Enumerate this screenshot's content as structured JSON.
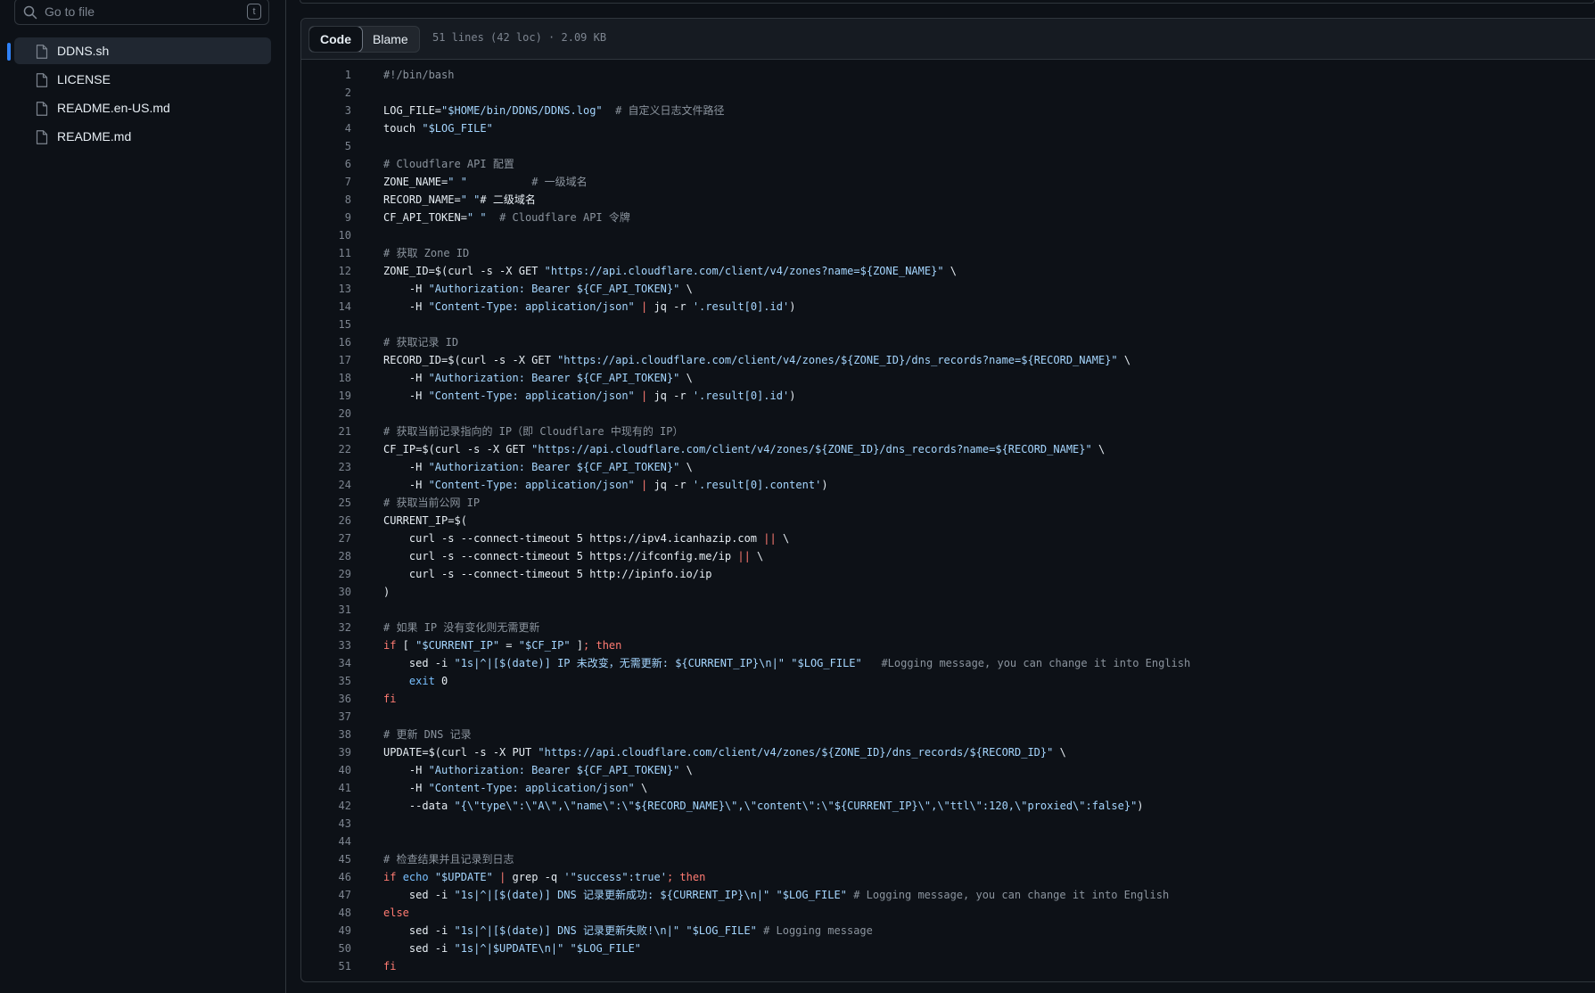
{
  "sidebar": {
    "search_placeholder": "Go to file",
    "search_shortcut": "t",
    "files": [
      {
        "name": "DDNS.sh",
        "active": true
      },
      {
        "name": "LICENSE",
        "active": false
      },
      {
        "name": "README.en-US.md",
        "active": false
      },
      {
        "name": "README.md",
        "active": false
      }
    ]
  },
  "code_view": {
    "tabs": [
      "Code",
      "Blame"
    ],
    "selected_tab": "Code",
    "meta": "51 lines (42 loc) · 2.09 KB",
    "lines": [
      "#!/bin/bash",
      "",
      "LOG_FILE=\"$HOME/bin/DDNS/DDNS.log\"  # 自定义日志文件路径",
      "touch \"$LOG_FILE\"",
      "",
      "# Cloudflare API 配置",
      "ZONE_NAME=\" \"          # 一级域名",
      "RECORD_NAME=\" \"# 二级域名",
      "CF_API_TOKEN=\" \"  # Cloudflare API 令牌",
      "",
      "# 获取 Zone ID",
      "ZONE_ID=$(curl -s -X GET \"https://api.cloudflare.com/client/v4/zones?name=${ZONE_NAME}\" \\",
      "    -H \"Authorization: Bearer ${CF_API_TOKEN}\" \\",
      "    -H \"Content-Type: application/json\" | jq -r '.result[0].id')",
      "",
      "# 获取记录 ID",
      "RECORD_ID=$(curl -s -X GET \"https://api.cloudflare.com/client/v4/zones/${ZONE_ID}/dns_records?name=${RECORD_NAME}\" \\",
      "    -H \"Authorization: Bearer ${CF_API_TOKEN}\" \\",
      "    -H \"Content-Type: application/json\" | jq -r '.result[0].id')",
      "",
      "# 获取当前记录指向的 IP（即 Cloudflare 中现有的 IP）",
      "CF_IP=$(curl -s -X GET \"https://api.cloudflare.com/client/v4/zones/${ZONE_ID}/dns_records?name=${RECORD_NAME}\" \\",
      "    -H \"Authorization: Bearer ${CF_API_TOKEN}\" \\",
      "    -H \"Content-Type: application/json\" | jq -r '.result[0].content')",
      "# 获取当前公网 IP",
      "CURRENT_IP=$(",
      "    curl -s --connect-timeout 5 https://ipv4.icanhazip.com || \\",
      "    curl -s --connect-timeout 5 https://ifconfig.me/ip || \\",
      "    curl -s --connect-timeout 5 http://ipinfo.io/ip",
      ")",
      "",
      "# 如果 IP 没有变化则无需更新",
      "if [ \"$CURRENT_IP\" = \"$CF_IP\" ]; then",
      "    sed -i \"1s|^|[$(date)] IP 未改变，无需更新: ${CURRENT_IP}\\n|\" \"$LOG_FILE\"   #Logging message, you can change it into English",
      "    exit 0",
      "fi",
      "",
      "# 更新 DNS 记录",
      "UPDATE=$(curl -s -X PUT \"https://api.cloudflare.com/client/v4/zones/${ZONE_ID}/dns_records/${RECORD_ID}\" \\",
      "    -H \"Authorization: Bearer ${CF_API_TOKEN}\" \\",
      "    -H \"Content-Type: application/json\" \\",
      "    --data \"{\\\"type\\\":\\\"A\\\",\\\"name\\\":\\\"${RECORD_NAME}\\\",\\\"content\\\":\\\"${CURRENT_IP}\\\",\\\"ttl\\\":120,\\\"proxied\\\":false}\")",
      "",
      "",
      "# 检查结果并且记录到日志",
      "if echo \"$UPDATE\" | grep -q '\"success\":true'; then",
      "    sed -i \"1s|^|[$(date)] DNS 记录更新成功: ${CURRENT_IP}\\n|\" \"$LOG_FILE\" # Logging message, you can change it into English",
      "else",
      "    sed -i \"1s|^|[$(date)] DNS 记录更新失败!\\n|\" \"$LOG_FILE\" # Logging message",
      "    sed -i \"1s|^|$UPDATE\\n|\" \"$LOG_FILE\"",
      "fi"
    ]
  },
  "colors": {
    "background": "#0d1117",
    "border": "#30363d",
    "accent": "#2f81f7",
    "comment": "#8b949e",
    "string": "#a5d6ff",
    "keyword": "#ff7b72"
  }
}
